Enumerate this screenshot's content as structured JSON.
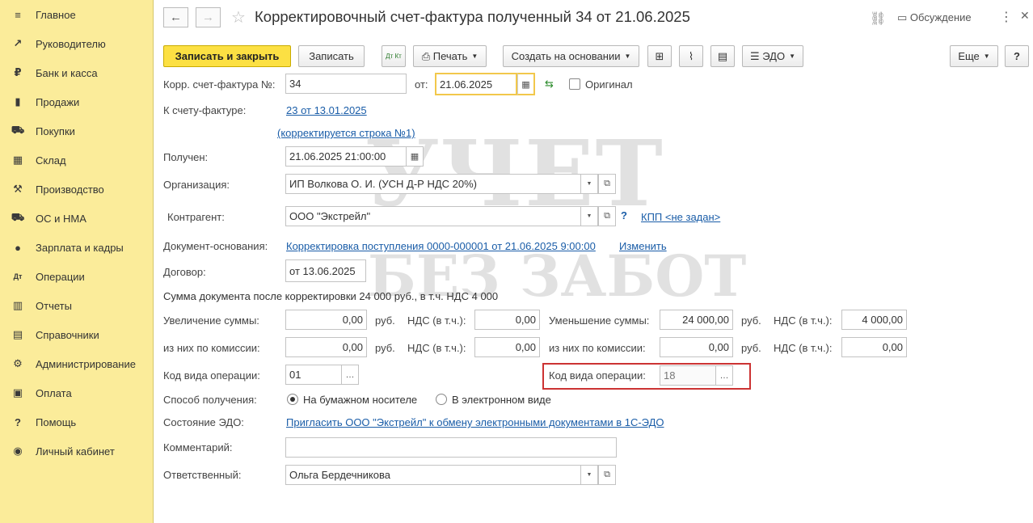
{
  "sidebar": {
    "items": [
      {
        "label": "Главное",
        "icon": "≡"
      },
      {
        "label": "Руководителю",
        "icon": "↗"
      },
      {
        "label": "Банк и касса",
        "icon": "₽"
      },
      {
        "label": "Продажи",
        "icon": "▮"
      },
      {
        "label": "Покупки",
        "icon": "⛟"
      },
      {
        "label": "Склад",
        "icon": "▦"
      },
      {
        "label": "Производство",
        "icon": "⚒"
      },
      {
        "label": "ОС и НМА",
        "icon": "⛟"
      },
      {
        "label": "Зарплата и кадры",
        "icon": "●"
      },
      {
        "label": "Операции",
        "icon": "Дт"
      },
      {
        "label": "Отчеты",
        "icon": "▥"
      },
      {
        "label": "Справочники",
        "icon": "▤"
      },
      {
        "label": "Администрирование",
        "icon": "⚙"
      },
      {
        "label": "Оплата",
        "icon": "▣"
      },
      {
        "label": "Помощь",
        "icon": "?"
      },
      {
        "label": "Личный кабинет",
        "icon": "◉"
      }
    ]
  },
  "header": {
    "title": "Корректировочный счет-фактура полученный 34 от 21.06.2025",
    "discussion": "Обсуждение"
  },
  "toolbar": {
    "save_close": "Записать и закрыть",
    "save": "Записать",
    "dt_kt": "Дт Кт",
    "print": "Печать",
    "create_based": "Создать на основании",
    "edo": "ЭДО",
    "more": "Еще",
    "help": "?"
  },
  "form": {
    "corr_invoice_label": "Корр. счет-фактура №:",
    "corr_invoice_value": "34",
    "from_label": "от:",
    "from_value": "21.06.2025",
    "original_label": "Оригинал",
    "to_invoice_label": "К счету-фактуре:",
    "to_invoice_link": "23 от 13.01.2025",
    "corrected_line_link": "(корректируется строка №1)",
    "received_label": "Получен:",
    "received_value": "21.06.2025 21:00:00",
    "org_label": "Организация:",
    "org_value": "ИП Волкова О. И. (УСН Д-Р НДС 20%)",
    "counterparty_label": "Контрагент:",
    "counterparty_value": "ООО \"Экстрейл\"",
    "kpp_link": "КПП <не задан>",
    "basis_label": "Документ-основания:",
    "basis_link": "Корректировка поступления 0000-000001 от 21.06.2025 9:00:00",
    "change_link": "Изменить",
    "contract_label": "Договор:",
    "contract_value": "от 13.06.2025",
    "sum_text": "Сумма документа после корректировки 24 000 руб., в т.ч. НДС 4 000",
    "increase_label": "Увеличение суммы:",
    "increase_value": "0,00",
    "rub": "руб.",
    "vat_label": "НДС (в т.ч.):",
    "increase_vat": "0,00",
    "decrease_label": "Уменьшение суммы:",
    "decrease_value": "24 000,00",
    "decrease_vat": "4 000,00",
    "commission_label": "из них по комиссии:",
    "commission_inc_value": "0,00",
    "commission_inc_vat": "0,00",
    "commission_dec_value": "0,00",
    "commission_dec_vat": "0,00",
    "op_code_label": "Код вида операции:",
    "op_code_left": "01",
    "op_code_right": "18",
    "receipt_method_label": "Способ получения:",
    "paper_option": "На бумажном носителе",
    "electronic_option": "В электронном виде",
    "edo_state_label": "Состояние ЭДО:",
    "edo_invite_link": "Пригласить ООО \"Экстрейл\" к обмену электронными документами в 1С-ЭДО",
    "comment_label": "Комментарий:",
    "comment_value": "",
    "responsible_label": "Ответственный:",
    "responsible_value": "Ольга Бердечникова"
  },
  "watermark": {
    "line1": "УЧЕТ",
    "line2": "БЕЗ ЗАБОТ"
  },
  "colors": {
    "sidebar_bg": "#fbec9a",
    "primary_button": "#fce043",
    "link": "#1a5da8",
    "highlight_border": "#cc3333"
  }
}
